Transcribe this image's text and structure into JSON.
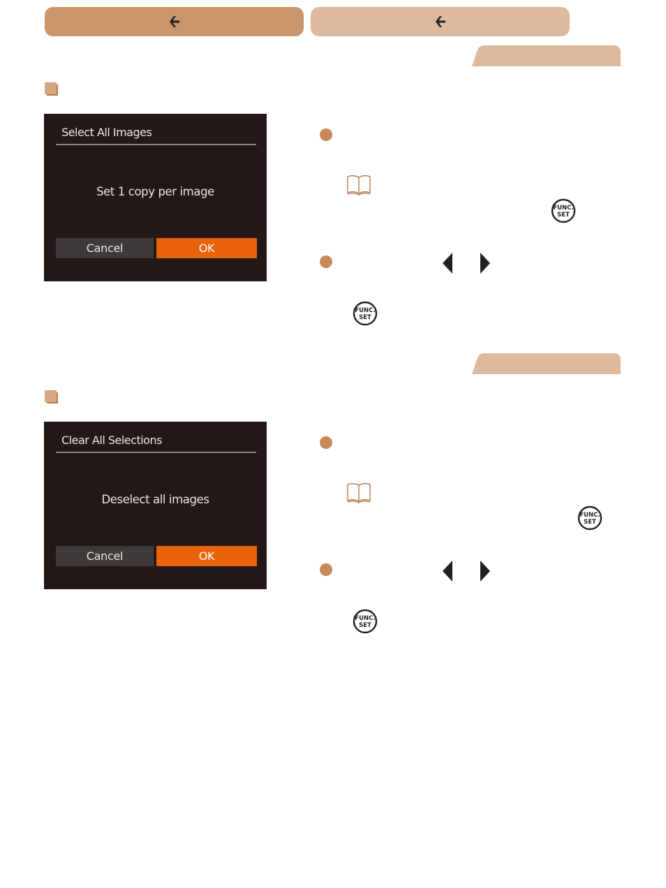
{
  "navigation": {
    "primary": {
      "icon": "arrow-left-icon",
      "color": "#c8956c"
    },
    "secondary": {
      "icon": "arrow-left-icon",
      "color": "#ddb99d"
    }
  },
  "sections": [
    {
      "id": "select-all",
      "tab_color": "#ddb99d",
      "screen": {
        "title": "Select All Images",
        "message": "Set 1 copy per image",
        "cancel_label": "Cancel",
        "ok_label": "OK"
      },
      "steps": [
        {
          "bullet_color": "#c8895a",
          "icons": [
            "book-icon",
            "func-set-icon"
          ]
        },
        {
          "bullet_color": "#c8895a",
          "icons": [
            "arrow-left-icon",
            "arrow-right-icon",
            "func-set-icon"
          ]
        }
      ]
    },
    {
      "id": "clear-all",
      "tab_color": "#ddb99d",
      "screen": {
        "title": "Clear All Selections",
        "message": "Deselect all images",
        "cancel_label": "Cancel",
        "ok_label": "OK"
      },
      "steps": [
        {
          "bullet_color": "#c8895a",
          "icons": [
            "book-icon",
            "func-set-icon"
          ]
        },
        {
          "bullet_color": "#c8895a",
          "icons": [
            "arrow-left-icon",
            "arrow-right-icon",
            "func-set-icon"
          ]
        }
      ]
    }
  ],
  "icons": {
    "func_line1": "FUNC.",
    "func_line2": "SET"
  },
  "colors": {
    "ok_button": "#e8630a",
    "cancel_button": "#3e3a39",
    "screen_bg": "#231815",
    "accent": "#c8895a"
  }
}
